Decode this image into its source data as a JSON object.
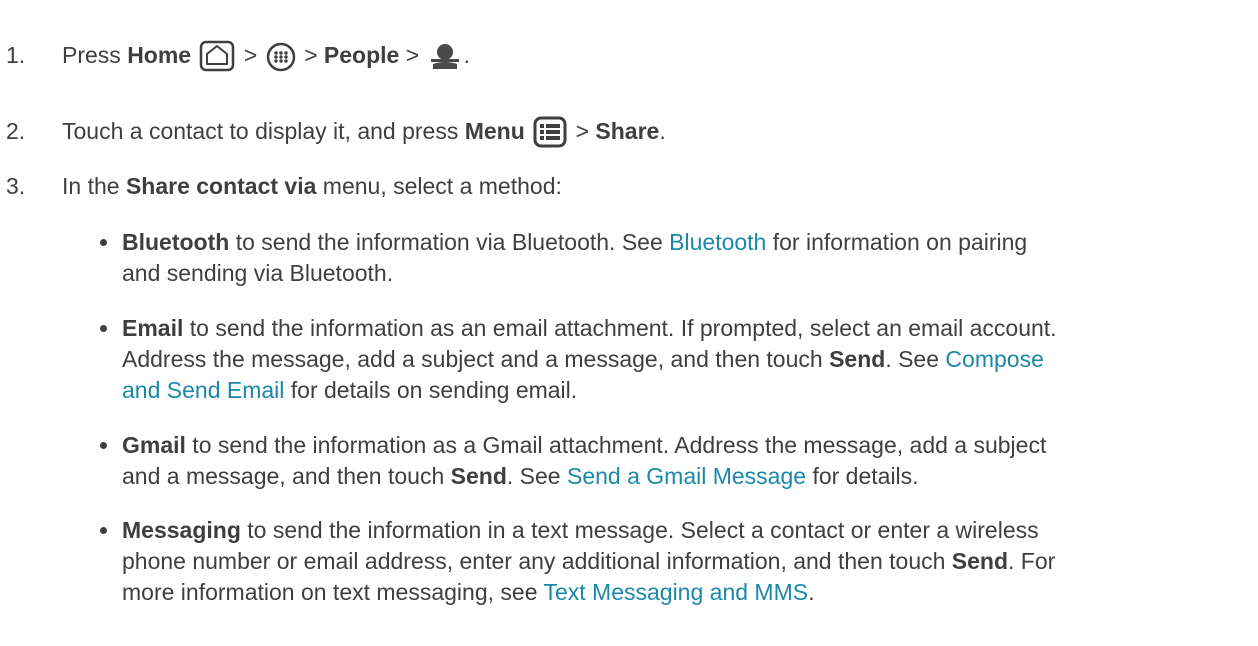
{
  "steps": [
    {
      "num": "1.",
      "pre": "Press ",
      "home": "Home",
      "sep1": " > ",
      "sep2": " > ",
      "people": "People",
      "sep3": " > ",
      "end": "."
    },
    {
      "num": "2.",
      "pre": "Touch a contact to display it, and press ",
      "menu": "Menu",
      "sep": " > ",
      "share": "Share",
      "end": "."
    },
    {
      "num": "3.",
      "pre": "In the ",
      "bold": "Share contact via",
      "post": " menu, select a method:"
    }
  ],
  "bullets": {
    "bluetooth": {
      "bold": "Bluetooth",
      "t1": " to send the information via Bluetooth. See ",
      "link": "Bluetooth",
      "t2": " for information on pairing",
      "line2": "and sending via Bluetooth."
    },
    "email": {
      "bold": "Email",
      "t1": " to send the information as an email attachment. If prompted, select an email account.",
      "line2a": "Address the message, add a subject and a message, and then touch ",
      "send": "Send",
      "line2b": ". See ",
      "link1": "Compose",
      "link2": "and Send Email",
      "line3": " for details on sending email."
    },
    "gmail": {
      "bold": "Gmail",
      "t1": " to send the information as a Gmail attachment. Address the message, add a subject",
      "line2a": "and a message, and then touch ",
      "send": "Send",
      "line2b": ". See ",
      "link": "Send a Gmail Message",
      "line2c": " for details."
    },
    "messaging": {
      "bold": "Messaging",
      "t1": " to send the information in a text message. Select a contact or enter a wireless",
      "line2a": "phone number or email address, enter any additional information, and then touch ",
      "send": "Send",
      "line2b": ". For",
      "line3a": "more information on text messaging, see ",
      "link": "Text Messaging and MMS",
      "line3b": "."
    }
  },
  "icons": {
    "home": "home-icon",
    "apps": "apps-icon",
    "person": "person-icon",
    "menu": "menu-icon"
  },
  "colors": {
    "text": "#3f3f3f",
    "link": "#1a88a9"
  }
}
